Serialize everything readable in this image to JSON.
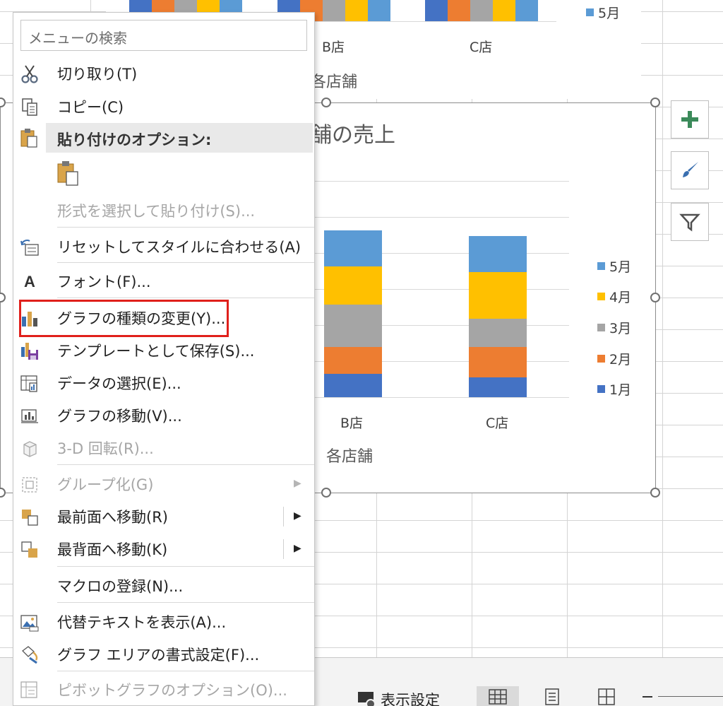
{
  "colors": {
    "m1": "#4472C4",
    "m2": "#ED7D31",
    "m3": "#A5A5A5",
    "m4": "#FFC000",
    "m5": "#5B9BD5",
    "highlight": "#E0201B"
  },
  "prev_chart": {
    "categories": [
      "B店",
      "C店"
    ],
    "axis_title": "各店舗",
    "legend_label": "5月"
  },
  "chart": {
    "title": "舗の売上",
    "axis_title": "各店舗",
    "categories": [
      "B店",
      "C店"
    ]
  },
  "chart_data": {
    "type": "bar",
    "stacked": true,
    "title": "舗の売上",
    "xlabel": "各店舗",
    "categories": [
      "B店",
      "C店"
    ],
    "series": [
      {
        "name": "1月",
        "values": [
          33,
          28
        ]
      },
      {
        "name": "2月",
        "values": [
          38,
          43
        ]
      },
      {
        "name": "3月",
        "values": [
          60,
          40
        ]
      },
      {
        "name": "4月",
        "values": [
          54,
          66
        ]
      },
      {
        "name": "5月",
        "values": [
          51,
          51
        ]
      }
    ],
    "legend_position": "right",
    "grid": true
  },
  "legend": [
    "5月",
    "4月",
    "3月",
    "2月",
    "1月"
  ],
  "side_buttons": [
    "plus-icon",
    "brush-icon",
    "filter-icon"
  ],
  "statusbar": {
    "display_settings": "表示設定"
  },
  "menu": {
    "search_placeholder": "メニューの検索",
    "paste_options_header": "貼り付けのオプション:",
    "items": {
      "cut": "切り取り(T)",
      "copy": "コピー(C)",
      "paste_special": "形式を選択して貼り付け(S)...",
      "reset_style": "リセットしてスタイルに合わせる(A)",
      "font": "フォント(F)...",
      "change_chart_type": "グラフの種類の変更(Y)...",
      "save_template": "テンプレートとして保存(S)...",
      "select_data": "データの選択(E)...",
      "move_chart": "グラフの移動(V)...",
      "rotation_3d": "3-D 回転(R)...",
      "group": "グループ化(G)",
      "bring_front": "最前面へ移動(R)",
      "send_back": "最背面へ移動(K)",
      "assign_macro": "マクロの登録(N)...",
      "alt_text": "代替テキストを表示(A)...",
      "format_chart_area": "グラフ エリアの書式設定(F)...",
      "pivot_options": "ピボットグラフのオプション(O)..."
    }
  }
}
